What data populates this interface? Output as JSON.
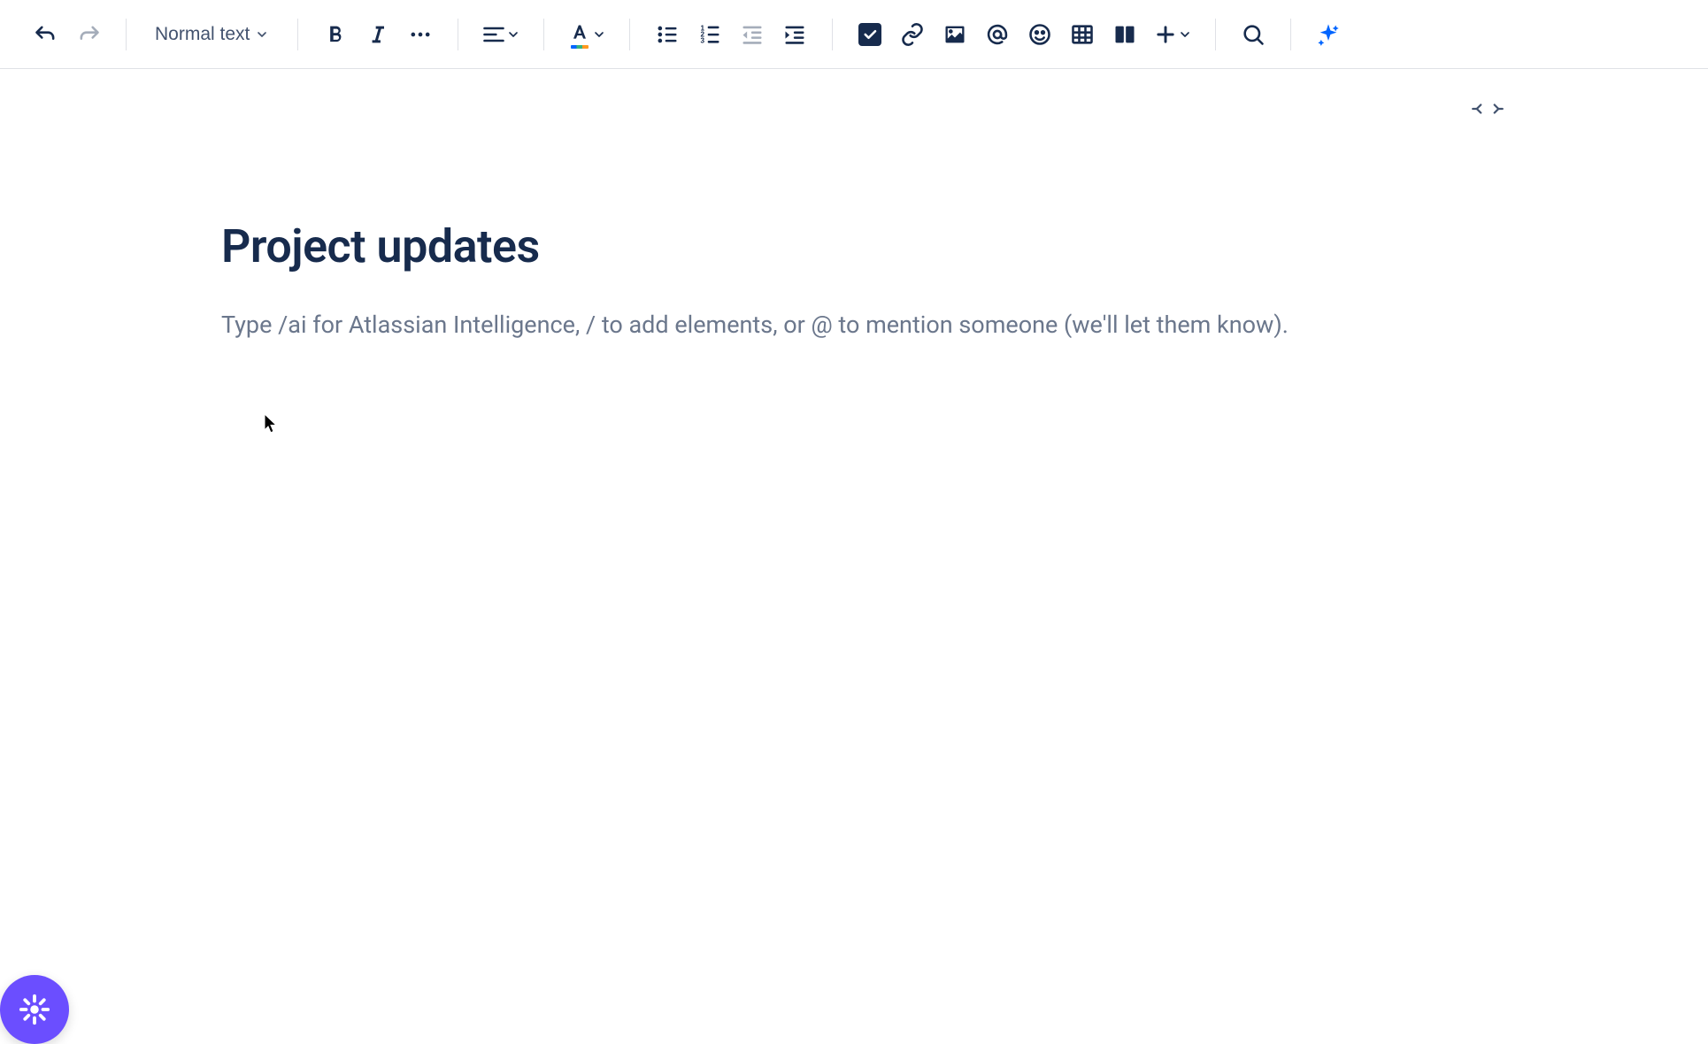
{
  "toolbar": {
    "text_style_label": "Normal text"
  },
  "document": {
    "title": "Project updates",
    "placeholder": "Type /ai for Atlassian Intelligence, / to add elements, or @ to mention someone (we'll let them know)."
  },
  "icons": {
    "undo": "undo-icon",
    "redo": "redo-icon",
    "bold": "bold-icon",
    "italic": "italic-icon",
    "more_formatting": "more-icon",
    "align": "align-left-icon",
    "text_color": "text-color-icon",
    "bullet_list": "bullet-list-icon",
    "numbered_list": "numbered-list-icon",
    "outdent": "outdent-icon",
    "indent": "indent-icon",
    "action_item": "action-item-icon",
    "link": "link-icon",
    "image": "image-icon",
    "mention": "mention-icon",
    "emoji": "emoji-icon",
    "table": "table-icon",
    "layouts": "layouts-icon",
    "insert": "plus-icon",
    "find": "search-icon",
    "ai": "sparkle-icon",
    "width": "width-toggle-icon",
    "fab": "loom-icon"
  }
}
